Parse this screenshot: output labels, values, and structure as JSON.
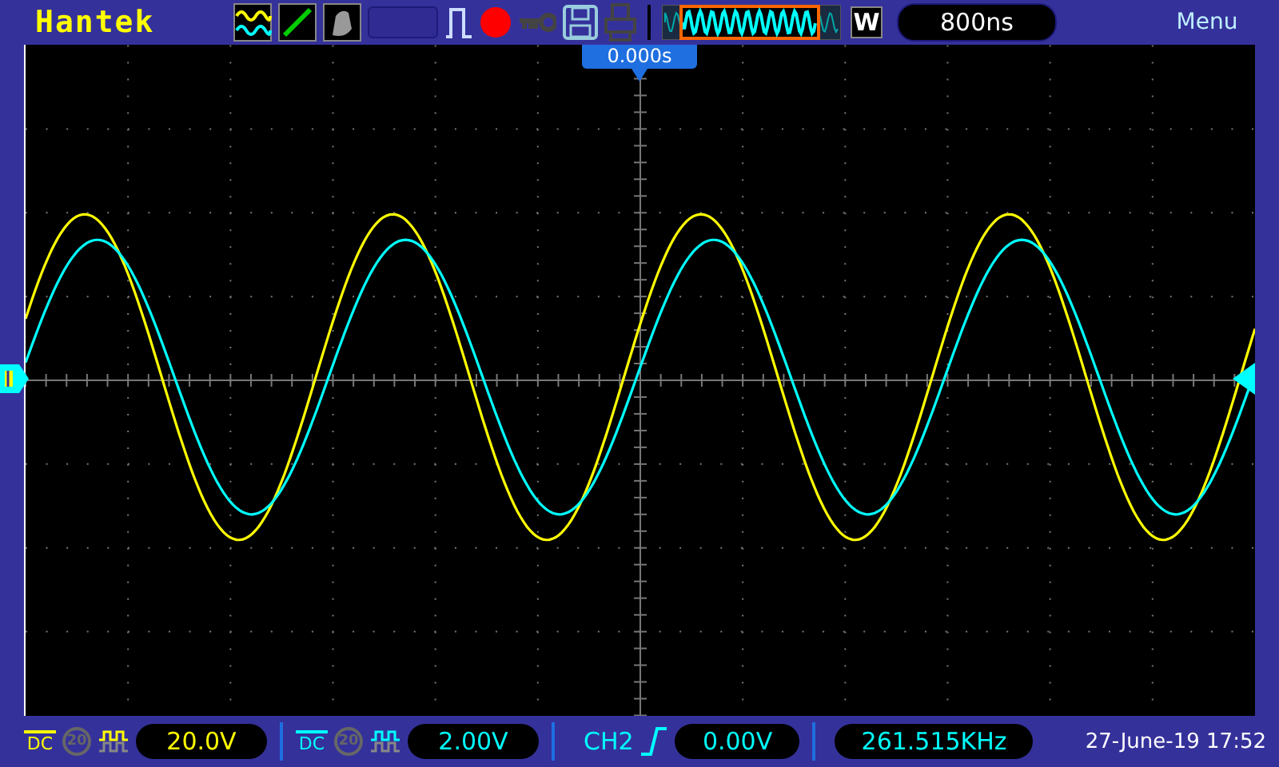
{
  "top_bar": {
    "brand": "Hantek",
    "zoom_button": "W",
    "timebase": "800ns",
    "menu": "Menu"
  },
  "screen": {
    "trigger_position": "0.000s"
  },
  "channels": [
    {
      "coupling": "DC",
      "bandwidth_label": "20",
      "bandwidth_limit": false,
      "scale": "20.0V",
      "color": "#ffff00"
    },
    {
      "coupling": "DC",
      "bandwidth_label": "20",
      "bandwidth_limit": false,
      "scale": "2.00V",
      "color": "#00ffff"
    }
  ],
  "trigger": {
    "source": "CH2",
    "rising_edge": true,
    "threshold": "0.00V"
  },
  "frequency": "261.515KHz",
  "datetime": "27-June-19 17:52"
}
